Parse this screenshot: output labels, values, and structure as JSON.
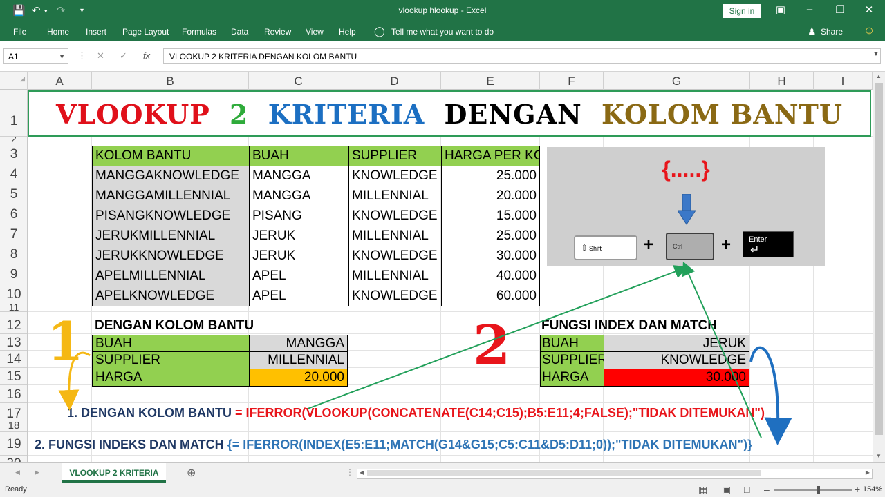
{
  "window": {
    "title": "vlookup hlookup  -  Excel",
    "sign_in": "Sign in",
    "share": "Share"
  },
  "ribbon": {
    "tabs": [
      "File",
      "Home",
      "Insert",
      "Page Layout",
      "Formulas",
      "Data",
      "Review",
      "View",
      "Help"
    ],
    "tell_me": "Tell me what you want to do"
  },
  "formula_bar": {
    "name_box": "A1",
    "fx_label": "fx",
    "content": "VLOOKUP 2 KRITERIA DENGAN KOLOM BANTU"
  },
  "columns": [
    "A",
    "B",
    "C",
    "D",
    "E",
    "F",
    "G",
    "H",
    "I"
  ],
  "rows": [
    "1",
    "2",
    "3",
    "4",
    "5",
    "6",
    "7",
    "8",
    "9",
    "10",
    "11",
    "12",
    "13",
    "14",
    "15",
    "16",
    "17",
    "18",
    "19",
    "20"
  ],
  "title_banner": {
    "w1": "VLOOKUP",
    "w2": "2",
    "w3": "KRITERIA",
    "w4": "DENGAN",
    "w5": "KOLOM BANTU",
    "colors": {
      "w1": "#e0101a",
      "w2": "#2eab3a",
      "w3": "#1c6fc2",
      "w4": "#000000",
      "w5": "#8a6914"
    }
  },
  "main_table": {
    "headers": [
      "KOLOM BANTU",
      "BUAH",
      "SUPPLIER",
      "HARGA PER KG"
    ],
    "rows": [
      [
        "MANGGAKNOWLEDGE",
        "MANGGA",
        "KNOWLEDGE",
        "25.000"
      ],
      [
        "MANGGAMILLENNIAL",
        "MANGGA",
        "MILLENNIAL",
        "20.000"
      ],
      [
        "PISANGKNOWLEDGE",
        "PISANG",
        "KNOWLEDGE",
        "15.000"
      ],
      [
        "JERUKMILLENNIAL",
        "JERUK",
        "MILLENNIAL",
        "25.000"
      ],
      [
        "JERUKKNOWLEDGE",
        "JERUK",
        "KNOWLEDGE",
        "30.000"
      ],
      [
        "APELMILLENNIAL",
        "APEL",
        "MILLENNIAL",
        "40.000"
      ],
      [
        "APELKNOWLEDGE",
        "APEL",
        "KNOWLEDGE",
        "60.000"
      ]
    ]
  },
  "lookup1": {
    "heading": "DENGAN KOLOM BANTU",
    "labels": [
      "BUAH",
      "SUPPLIER",
      "HARGA"
    ],
    "values": [
      "MANGGA",
      "MILLENNIAL",
      "20.000"
    ],
    "marker": "1",
    "result_color": "#ffc000"
  },
  "lookup2": {
    "heading": "FUNGSI INDEX DAN MATCH",
    "labels": [
      "BUAH",
      "SUPPLIER",
      "HARGA"
    ],
    "values": [
      "JERUK",
      "KNOWLEDGE",
      "30.000"
    ],
    "marker": "2",
    "result_color": "#ff0000"
  },
  "keyboard_hint": {
    "braces": "{.....}",
    "shift_key": "Shift",
    "ctrl_key": "Ctrl",
    "enter_key": "Enter",
    "plus": "+"
  },
  "formula1": {
    "label": "1. DENGAN KOLOM BANTU",
    "formula": "= IFERROR(VLOOKUP(CONCATENATE(C14;C15);B5:E11;4;FALSE);\"TIDAK DITEMUKAN\")"
  },
  "formula2": {
    "label": "2.  FUNGSI INDEKS DAN MATCH",
    "formula": "{= IFERROR(INDEX(E5:E11;MATCH(G14&G15;C5:C11&D5:D11;0));\"TIDAK DITEMUKAN\")}"
  },
  "sheet_tab": "VLOOKUP 2 KRITERIA",
  "status": {
    "ready": "Ready",
    "zoom": "154%"
  }
}
